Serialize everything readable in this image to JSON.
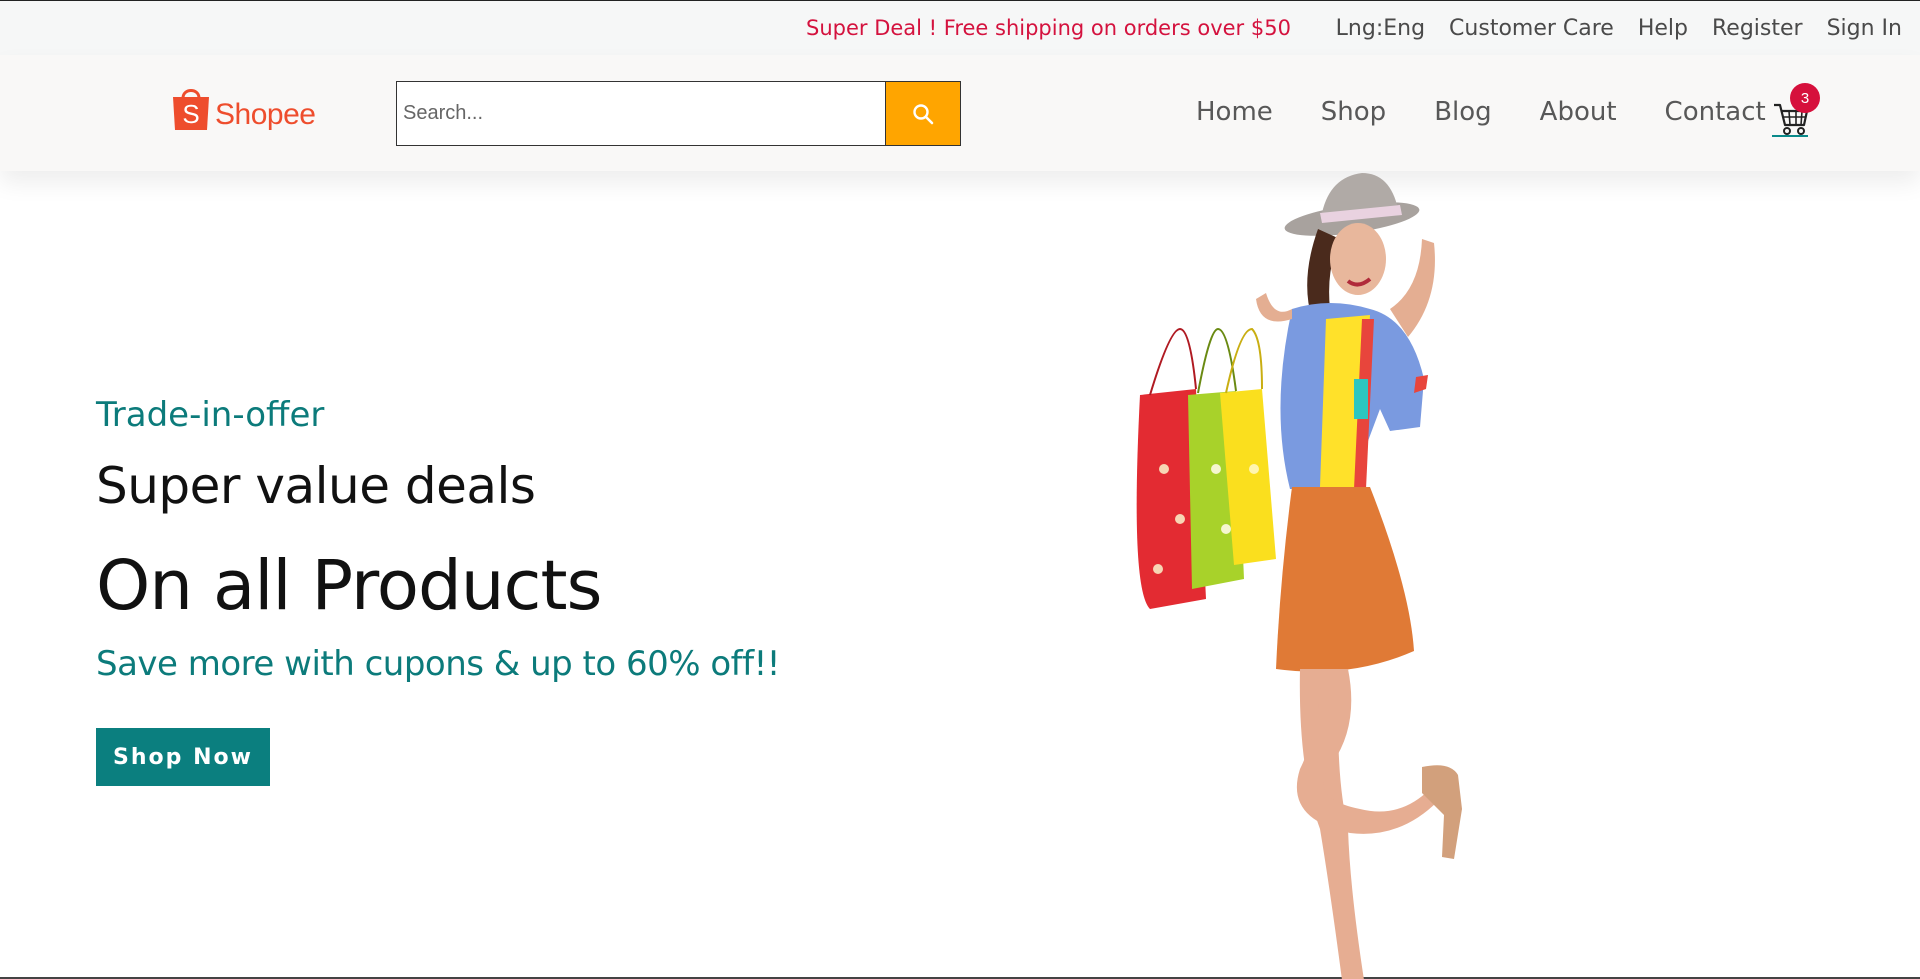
{
  "topbar": {
    "promo": "Super Deal ! Free shipping on orders over $50",
    "links": [
      "Lng:Eng",
      "Customer Care",
      "Help",
      "Register",
      "Sign In"
    ]
  },
  "header": {
    "logo_text": "Shopee",
    "logo_letter": "S",
    "search_placeholder": "Search...",
    "search_icon": "search-icon",
    "nav": [
      "Home",
      "Shop",
      "Blog",
      "About",
      "Contact"
    ],
    "cart_icon": "cart-icon",
    "cart_count": "3"
  },
  "hero": {
    "eyebrow": "Trade-in-offer",
    "headline": "Super value deals",
    "title": "On all Products",
    "subtitle": "Save more with cupons & up to 60% off!!",
    "cta": "Shop Now"
  },
  "colors": {
    "accent_teal": "#0b7f7f",
    "promo_red": "#d4123e",
    "search_button": "#ffa500",
    "brand_orange": "#ee4d2d",
    "badge_red": "#d6103c"
  }
}
